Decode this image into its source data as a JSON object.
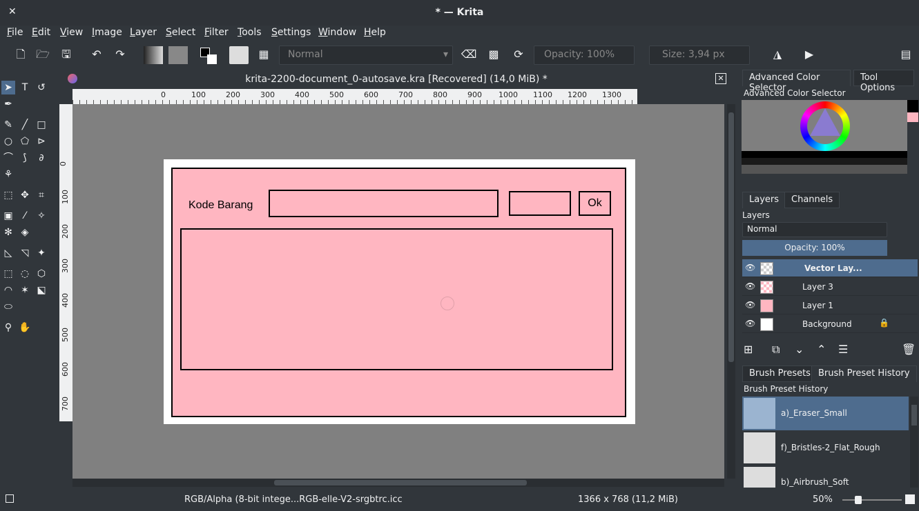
{
  "window": {
    "title": "* — Krita",
    "close": "✕"
  },
  "menu": [
    "File",
    "Edit",
    "View",
    "Image",
    "Layer",
    "Select",
    "Filter",
    "Tools",
    "Settings",
    "Window",
    "Help"
  ],
  "toolbar": {
    "blend_mode": "Normal",
    "opacity": "Opacity:  100%",
    "size": "Size:  3,94 px"
  },
  "document": {
    "tab_title": "krita-2200-document_0-autosave.kra [Recovered]  (14,0 MiB) *"
  },
  "ruler": {
    "h_ticks": [
      "0",
      "100",
      "200",
      "300",
      "400",
      "500",
      "600",
      "700",
      "800",
      "900",
      "1000",
      "1100",
      "1200",
      "1300"
    ],
    "v_ticks": [
      "0",
      "100",
      "200",
      "300",
      "400",
      "500",
      "600",
      "700"
    ]
  },
  "canvas_content": {
    "label": "Kode Barang",
    "ok_button": "Ok",
    "page_color": "#ffb6c1"
  },
  "right_panel": {
    "top_tabs": [
      "Advanced Color Selector",
      "Tool Options"
    ],
    "color_selector_title": "Advanced Color Selector",
    "layers_tabs": [
      "Layers",
      "Channels"
    ],
    "layers_title": "Layers",
    "blend_mode": "Normal",
    "opacity": "Opacity:  100%",
    "layers": [
      {
        "name": "Vector Lay...",
        "selected": true
      },
      {
        "name": "Layer 3",
        "selected": false
      },
      {
        "name": "Layer 1",
        "selected": false
      },
      {
        "name": "Background",
        "selected": false
      }
    ],
    "brush_tabs": [
      "Brush Presets",
      "Brush Preset History"
    ],
    "brush_title": "Brush Preset History",
    "brushes": [
      "a)_Eraser_Small",
      "f)_Bristles-2_Flat_Rough",
      "b)_Airbrush_Soft"
    ]
  },
  "status": {
    "color_space": "RGB/Alpha (8-bit intege...RGB-elle-V2-srgbtrc.icc",
    "dimensions": "1366 x 768 (11,2 MiB)",
    "zoom": "50%"
  },
  "colors": {
    "accent": "#4e6c8e",
    "background": "#31363b",
    "canvas_gray": "#808080",
    "pink": "#ffb6c1"
  }
}
